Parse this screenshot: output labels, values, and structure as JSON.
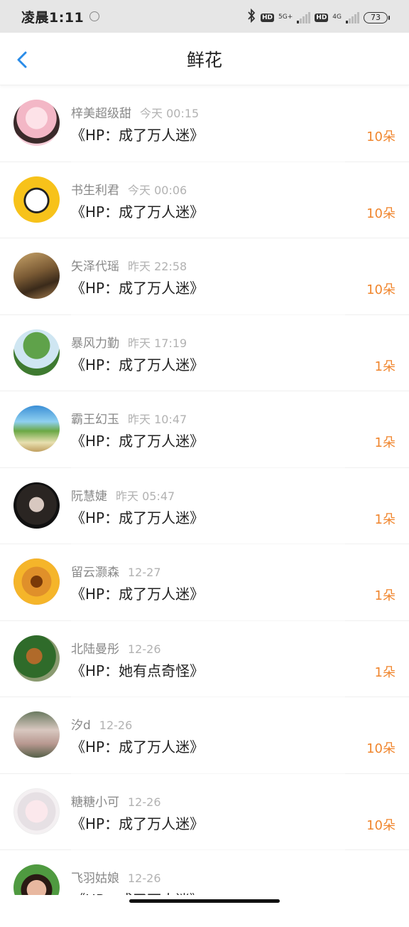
{
  "status": {
    "time": "凌晨1:11",
    "net1": "5G+",
    "net2": "4G",
    "hd": "HD",
    "battery": "73"
  },
  "header": {
    "title": "鲜花"
  },
  "items": [
    {
      "user": "梓美超级甜",
      "date": "今天 00:15",
      "book": "《HP：成了万人迷》",
      "count": "10朵"
    },
    {
      "user": "书生利君",
      "date": "今天 00:06",
      "book": "《HP：成了万人迷》",
      "count": "10朵"
    },
    {
      "user": "矢泽代瑶",
      "date": "昨天 22:58",
      "book": "《HP：成了万人迷》",
      "count": "10朵"
    },
    {
      "user": "暴风力勤",
      "date": "昨天 17:19",
      "book": "《HP：成了万人迷》",
      "count": "1朵"
    },
    {
      "user": "霸王幻玉",
      "date": "昨天 10:47",
      "book": "《HP：成了万人迷》",
      "count": "1朵"
    },
    {
      "user": "阮慧婕",
      "date": "昨天 05:47",
      "book": "《HP：成了万人迷》",
      "count": "1朵"
    },
    {
      "user": "留云灏森",
      "date": "12-27",
      "book": "《HP：成了万人迷》",
      "count": "1朵"
    },
    {
      "user": "北陆曼彤",
      "date": "12-26",
      "book": "《HP：她有点奇怪》",
      "count": "1朵"
    },
    {
      "user": "汐d",
      "date": "12-26",
      "book": "《HP：成了万人迷》",
      "count": "10朵"
    },
    {
      "user": "糖糖小可",
      "date": "12-26",
      "book": "《HP：成了万人迷》",
      "count": "10朵"
    },
    {
      "user": "飞羽姑娘",
      "date": "12-26",
      "book": "《HP：成了万人迷》",
      "count": ""
    }
  ],
  "colors": {
    "accent_count": "#f0862e",
    "back_arrow": "#2a8ce8"
  }
}
